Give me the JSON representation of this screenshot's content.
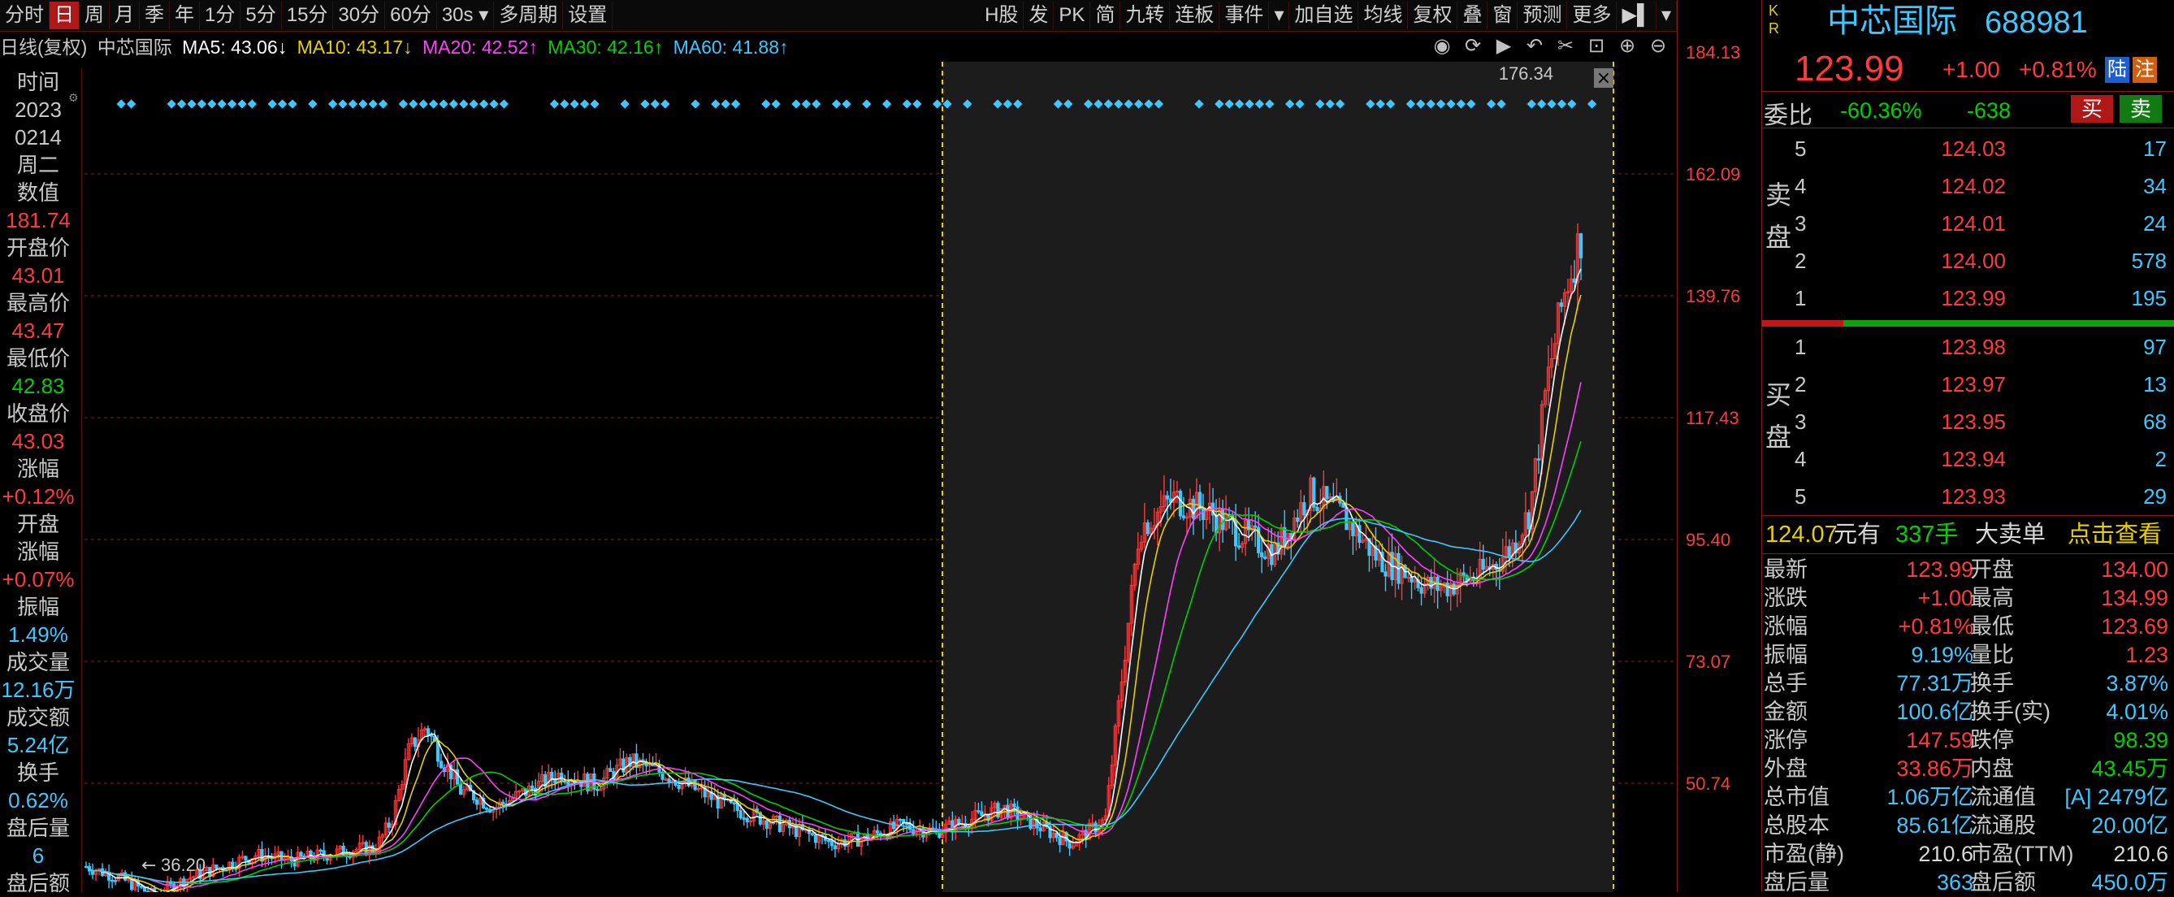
{
  "toolbar": {
    "left": [
      {
        "label": "分时",
        "active": false
      },
      {
        "label": "日",
        "active": true
      },
      {
        "label": "周",
        "active": false
      },
      {
        "label": "月",
        "active": false
      },
      {
        "label": "季",
        "active": false
      },
      {
        "label": "年",
        "active": false
      },
      {
        "label": "1分",
        "active": false
      },
      {
        "label": "5分",
        "active": false
      },
      {
        "label": "15分",
        "active": false
      },
      {
        "label": "30分",
        "active": false
      },
      {
        "label": "60分",
        "active": false
      },
      {
        "label": "30s ▾",
        "active": false
      },
      {
        "label": "多周期",
        "active": false
      },
      {
        "label": "设置",
        "active": false
      }
    ],
    "right": [
      "H股",
      "发",
      "PK",
      "简",
      "九转",
      "连板",
      "事件",
      "▾",
      "加自选",
      "均线",
      "复权",
      "叠",
      "窗",
      "预测",
      "更多",
      "▶▌",
      "▾"
    ]
  },
  "ma_row": {
    "prefix": "日线(复权)",
    "stock": "中芯国际",
    "ma5": "MA5: 43.06↓",
    "ma10": "MA10: 43.17↓",
    "ma20": "MA20: 42.52↑",
    "ma30": "MA30: 42.16↑",
    "ma60": "MA60: 41.88↑"
  },
  "colors": {
    "ma5": "#ffffff",
    "ma10": "#e6d000",
    "ma20": "#ff40ff",
    "ma30": "#00d000",
    "ma60": "#3ec7ff",
    "up": "#ff3a3a",
    "down": "#3ec7ff",
    "grid": "#8a1a1a"
  },
  "left_panel": [
    {
      "text": "时间",
      "cls": "lbl"
    },
    {
      "text": "2023",
      "cls": "lbl"
    },
    {
      "text": "0214",
      "cls": "lbl"
    },
    {
      "text": "周二",
      "cls": "lbl"
    },
    {
      "text": "数值",
      "cls": "lbl"
    },
    {
      "text": "181.74",
      "cls": "red"
    },
    {
      "text": "开盘价",
      "cls": "lbl"
    },
    {
      "text": "43.01",
      "cls": "red"
    },
    {
      "text": "最高价",
      "cls": "lbl"
    },
    {
      "text": "43.47",
      "cls": "red"
    },
    {
      "text": "最低价",
      "cls": "lbl"
    },
    {
      "text": "42.83",
      "cls": "green"
    },
    {
      "text": "收盘价",
      "cls": "lbl"
    },
    {
      "text": "43.03",
      "cls": "red"
    },
    {
      "text": "涨幅",
      "cls": "lbl"
    },
    {
      "text": "+0.12%",
      "cls": "red"
    },
    {
      "text": "开盘",
      "cls": "lbl"
    },
    {
      "text": "涨幅",
      "cls": "lbl"
    },
    {
      "text": "+0.07%",
      "cls": "red"
    },
    {
      "text": "振幅",
      "cls": "lbl"
    },
    {
      "text": "1.49%",
      "cls": "cyan"
    },
    {
      "text": "成交量",
      "cls": "lbl"
    },
    {
      "text": "12.16万",
      "cls": "cyan"
    },
    {
      "text": "成交额",
      "cls": "lbl"
    },
    {
      "text": "5.24亿",
      "cls": "cyan"
    },
    {
      "text": "换手",
      "cls": "lbl"
    },
    {
      "text": "0.62%",
      "cls": "cyan"
    },
    {
      "text": "盘后量",
      "cls": "lbl"
    },
    {
      "text": "6",
      "cls": "cyan"
    },
    {
      "text": "盘后额",
      "cls": "lbl"
    }
  ],
  "axis_labels": [
    "184.13",
    "162.09",
    "139.76",
    "117.43",
    "95.40",
    "73.07",
    "50.74"
  ],
  "chart_labels": {
    "high": "176.34",
    "low": "36.20"
  },
  "chart_data": {
    "type": "line",
    "x": [
      0,
      20,
      40,
      60,
      80,
      100,
      120,
      140,
      160,
      170,
      180,
      190,
      200,
      205,
      210,
      215,
      220,
      230,
      240,
      260,
      280,
      300,
      320,
      340,
      360,
      380,
      400,
      420,
      440,
      460,
      480,
      500,
      520,
      540,
      560,
      580,
      600,
      620,
      640,
      660,
      680,
      700,
      720,
      740,
      760,
      780,
      790,
      800,
      810,
      820,
      830,
      840,
      850,
      860,
      870,
      880
    ],
    "y": [
      42,
      40,
      37,
      40,
      42,
      44,
      43,
      44,
      45,
      45,
      50,
      62,
      66,
      63,
      60,
      58,
      55,
      54,
      52,
      55,
      58,
      56,
      60,
      58,
      55,
      52,
      50,
      48,
      46,
      47,
      49,
      48,
      50,
      52,
      49,
      46,
      50,
      100,
      105,
      103,
      99,
      96,
      106,
      102,
      95,
      92,
      90,
      90,
      91,
      92,
      94,
      97,
      103,
      125,
      140,
      150
    ],
    "ylim": [
      36.2,
      184.13
    ]
  },
  "quote": {
    "kr": "K R",
    "name": "中芯国际",
    "code": "688981",
    "price": "123.99",
    "change": "+1.00",
    "pct": "+0.81%",
    "tag1": "陆",
    "tag2": "注",
    "wb_label": "委比",
    "wb_pct": "-60.36%",
    "wb_diff": "-638",
    "buy_btn": "买",
    "sell_btn": "卖",
    "sell_label": [
      "卖",
      "盘"
    ],
    "buy_label": [
      "买",
      "盘"
    ],
    "asks": [
      {
        "n": "5",
        "p": "124.03",
        "v": "17"
      },
      {
        "n": "4",
        "p": "124.02",
        "v": "34"
      },
      {
        "n": "3",
        "p": "124.01",
        "v": "24"
      },
      {
        "n": "2",
        "p": "124.00",
        "v": "578"
      },
      {
        "n": "1",
        "p": "123.99",
        "v": "195"
      }
    ],
    "bids": [
      {
        "n": "1",
        "p": "123.98",
        "v": "97"
      },
      {
        "n": "2",
        "p": "123.97",
        "v": "13"
      },
      {
        "n": "3",
        "p": "123.95",
        "v": "68"
      },
      {
        "n": "4",
        "p": "123.94",
        "v": "2"
      },
      {
        "n": "5",
        "p": "123.93",
        "v": "29"
      }
    ],
    "bigorder": {
      "price": "124.07",
      "unit": "元有",
      "vol": "337手",
      "label": "大卖单",
      "link": "点击查看"
    },
    "stats": [
      {
        "l": "最新",
        "lv": "123.99",
        "lc": "r",
        "r": "开盘",
        "rv": "134.00",
        "rc": "r"
      },
      {
        "l": "涨跌",
        "lv": "+1.00",
        "lc": "r",
        "r": "最高",
        "rv": "134.99",
        "rc": "r"
      },
      {
        "l": "涨幅",
        "lv": "+0.81%",
        "lc": "r",
        "r": "最低",
        "rv": "123.69",
        "rc": "r"
      },
      {
        "l": "振幅",
        "lv": "9.19%",
        "lc": "c",
        "r": "量比",
        "rv": "1.23",
        "rc": "r"
      },
      {
        "l": "总手",
        "lv": "77.31万",
        "lc": "c",
        "r": "换手",
        "rv": "3.87%",
        "rc": "c"
      },
      {
        "l": "金额",
        "lv": "100.6亿",
        "lc": "c",
        "r": "换手(实)",
        "rv": "4.01%",
        "rc": "c"
      },
      {
        "l": "涨停",
        "lv": "147.59",
        "lc": "r",
        "r": "跌停",
        "rv": "98.39",
        "rc": "g"
      },
      {
        "l": "外盘",
        "lv": "33.86万",
        "lc": "r",
        "r": "内盘",
        "rv": "43.45万",
        "rc": "g"
      },
      {
        "l": "总市值",
        "lv": "1.06万亿",
        "lc": "c",
        "r": "流通值",
        "rv": "[A] 2479亿",
        "rc": "c"
      },
      {
        "l": "总股本",
        "lv": "85.61亿",
        "lc": "c",
        "r": "流通股",
        "rv": "20.00亿",
        "rc": "c"
      },
      {
        "l": "市盈(静)",
        "lv": "210.6",
        "lc": "w",
        "r": "市盈(TTM)",
        "rv": "210.6",
        "rc": "w"
      },
      {
        "l": "盘后量",
        "lv": "363",
        "lc": "c",
        "r": "盘后额",
        "rv": "450.0万",
        "rc": "c"
      }
    ]
  }
}
